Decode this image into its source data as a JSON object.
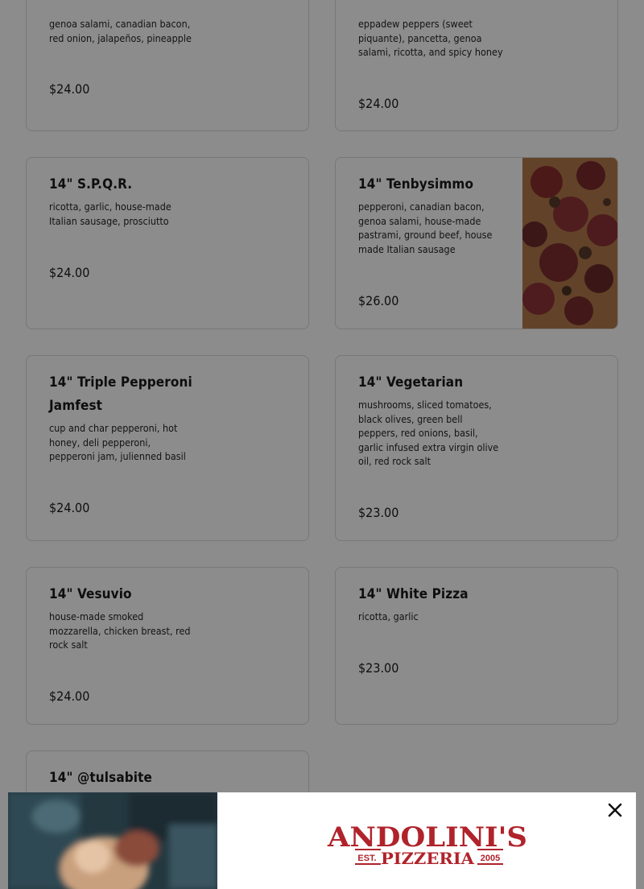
{
  "menu": {
    "items": [
      {
        "name": "",
        "desc": "genoa salami, canadian bacon, red onion, jalapeños, pineapple",
        "price": "$24.00"
      },
      {
        "name": "",
        "desc": "eppadew peppers (sweet piquante), pancetta, genoa salami, ricotta, and spicy honey",
        "price": "$24.00"
      },
      {
        "name": "14\" S.P.Q.R.",
        "desc": "ricotta, garlic, house-made Italian sausage, prosciutto",
        "price": "$24.00"
      },
      {
        "name": "14\" Tenbysimmo",
        "desc": "pepperoni, canadian bacon, genoa salami, house-made pastrami, ground beef, house made Italian sausage",
        "price": "$26.00"
      },
      {
        "name": "14\" Triple Pepperoni Jamfest",
        "desc": "cup and char pepperoni, hot honey, deli pepperoni, pepperoni jam, julienned basil",
        "price": "$24.00"
      },
      {
        "name": "14\" Vegetarian",
        "desc": "mushrooms, sliced tomatoes, black olives, green bell peppers, red onions, basil, garlic infused extra virgin olive oil, red rock salt",
        "price": "$23.00"
      },
      {
        "name": "14\" Vesuvio",
        "desc": "house-made smoked mozzarella, chicken breast, red rock salt",
        "price": "$24.00"
      },
      {
        "name": "14\" White Pizza",
        "desc": "ricotta, garlic",
        "price": "$23.00"
      },
      {
        "name": "14\" @tulsabite",
        "desc": "",
        "price": ""
      }
    ]
  },
  "modal": {
    "logo_name": "ANDOLINI'S",
    "logo_est": "EST.",
    "logo_sub": "PIZZERIA",
    "logo_year": "2005",
    "close_icon": "close-icon"
  },
  "colors": {
    "overlay": "rgba(0,0,0,0.45)",
    "brand_red": "#b0232b"
  }
}
